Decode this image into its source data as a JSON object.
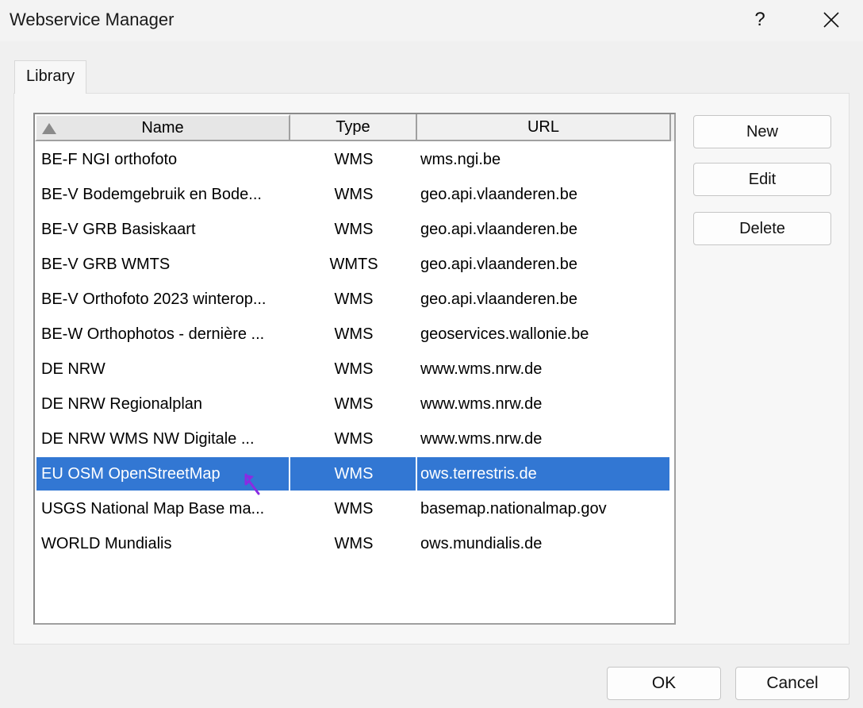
{
  "window": {
    "title": "Webservice Manager",
    "help_label": "?"
  },
  "tabs": [
    {
      "label": "Library",
      "active": true
    }
  ],
  "list": {
    "columns": {
      "name": "Name",
      "type": "Type",
      "url": "URL"
    },
    "sort_icon": "sort-ascending-icon",
    "rows": [
      {
        "name": "BE-F NGI orthofoto",
        "type": "WMS",
        "url": "wms.ngi.be"
      },
      {
        "name": "BE-V Bodemgebruik en Bode...",
        "type": "WMS",
        "url": "geo.api.vlaanderen.be"
      },
      {
        "name": "BE-V GRB Basiskaart",
        "type": "WMS",
        "url": "geo.api.vlaanderen.be"
      },
      {
        "name": "BE-V GRB WMTS",
        "type": "WMTS",
        "url": "geo.api.vlaanderen.be"
      },
      {
        "name": "BE-V Orthofoto 2023 winterop...",
        "type": "WMS",
        "url": "geo.api.vlaanderen.be"
      },
      {
        "name": "BE-W Orthophotos - dernière ...",
        "type": "WMS",
        "url": "geoservices.wallonie.be"
      },
      {
        "name": "DE NRW",
        "type": "WMS",
        "url": "www.wms.nrw.de"
      },
      {
        "name": "DE NRW Regionalplan",
        "type": "WMS",
        "url": "www.wms.nrw.de"
      },
      {
        "name": "DE NRW WMS NW Digitale ...",
        "type": "WMS",
        "url": "www.wms.nrw.de"
      },
      {
        "name": "EU OSM OpenStreetMap",
        "type": "WMS",
        "url": "ows.terrestris.de",
        "selected": true
      },
      {
        "name": "USGS National Map Base ma...",
        "type": "WMS",
        "url": "basemap.nationalmap.gov"
      },
      {
        "name": "WORLD Mundialis",
        "type": "WMS",
        "url": "ows.mundialis.de"
      }
    ]
  },
  "side_buttons": {
    "new": "New",
    "edit": "Edit",
    "delete": "Delete"
  },
  "footer_buttons": {
    "ok": "OK",
    "cancel": "Cancel"
  },
  "colors": {
    "selection": "#3277d3",
    "cursor": "#8a2be2"
  }
}
